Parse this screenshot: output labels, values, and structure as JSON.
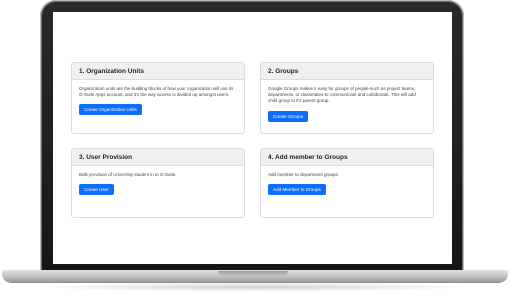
{
  "cards": [
    {
      "title": "1. Organization Units",
      "description": "Organization units are the building blocks of how your organization will use its G-Suite Apps account, and it's the way access is divided up amongst users.",
      "button_label": "Create Organization Units"
    },
    {
      "title": "2. Groups",
      "description": "Google Groups makes it easy for groups of people-such as project teams, departments, or classmates-to communicate and collaborate. This will add child group to it's parent group.",
      "button_label": "Create Groups"
    },
    {
      "title": "3. User Provision",
      "description": "Bulk provision of University student in to G-Suite.",
      "button_label": "Create User"
    },
    {
      "title": "4. Add member to Groups",
      "description": "Add member to department groups.",
      "button_label": "Add Member to Groups"
    }
  ],
  "colors": {
    "primary_button": "#0d6efd",
    "card_header_bg": "#f0f0f0",
    "card_border": "#dcdcdc"
  }
}
